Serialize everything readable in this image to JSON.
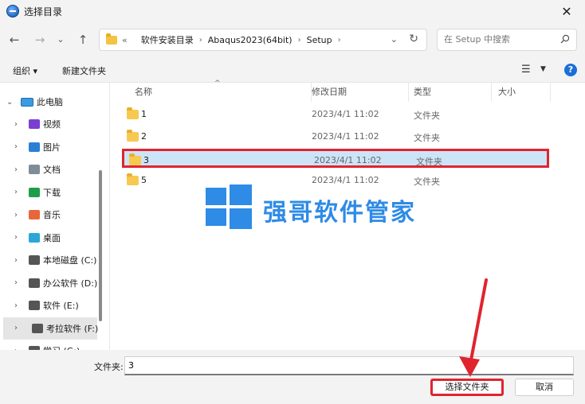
{
  "window": {
    "title": "选择目录",
    "close_glyph": "✕"
  },
  "navbar": {
    "back_glyph": "←",
    "forward_glyph": "→",
    "recent_glyph": "⌄",
    "up_glyph": "↑",
    "breadcrumb_prefix": "«",
    "breadcrumb": [
      "软件安装目录",
      "Abaqus2023(64bit)",
      "Setup"
    ],
    "search_placeholder": "在 Setup 中搜索",
    "refresh_glyph": "↻",
    "dropdown_glyph": "⌄"
  },
  "toolbar": {
    "organize": "组织 ▾",
    "new_folder": "新建文件夹",
    "view_glyph": "☰",
    "view_dd": "▼",
    "help_glyph": "?"
  },
  "sidebar": {
    "root": "此电脑",
    "items": [
      {
        "label": "视频",
        "icon": "video-icon",
        "color": "#7a3fd1"
      },
      {
        "label": "图片",
        "icon": "picture-icon",
        "color": "#2a7fd4"
      },
      {
        "label": "文档",
        "icon": "document-icon",
        "color": "#7f8c99"
      },
      {
        "label": "下载",
        "icon": "download-icon",
        "color": "#1f9e4a"
      },
      {
        "label": "音乐",
        "icon": "music-icon",
        "color": "#e8673a"
      },
      {
        "label": "桌面",
        "icon": "desktop-icon",
        "color": "#2aa7d8"
      },
      {
        "label": "本地磁盘 (C:)",
        "icon": "drive-c-icon",
        "color": "#555555"
      },
      {
        "label": "办公软件 (D:)",
        "icon": "drive-icon",
        "color": "#555555"
      },
      {
        "label": "软件 (E:)",
        "icon": "drive-icon",
        "color": "#555555"
      },
      {
        "label": "考拉软件 (F:)",
        "icon": "drive-icon",
        "color": "#555555"
      },
      {
        "label": "学习 (G:)",
        "icon": "drive-icon",
        "color": "#555555"
      }
    ],
    "chevron_glyph": "›",
    "chevron_open_glyph": "⌄"
  },
  "columns": {
    "name": "名称",
    "modified": "修改日期",
    "type": "类型",
    "size": "大小",
    "sort_glyph": "^"
  },
  "files": [
    {
      "name": "1",
      "modified": "2023/4/1 11:02",
      "type": "文件夹"
    },
    {
      "name": "2",
      "modified": "2023/4/1 11:02",
      "type": "文件夹"
    },
    {
      "name": "3",
      "modified": "2023/4/1 11:02",
      "type": "文件夹"
    },
    {
      "name": "5",
      "modified": "2023/4/1 11:02",
      "type": "文件夹"
    }
  ],
  "watermark": "强哥软件管家",
  "bottom": {
    "folder_label": "文件夹:",
    "folder_value": "3",
    "select_button": "选择文件夹",
    "cancel_button": "取消"
  },
  "colors": {
    "accent": "#2e8be6",
    "highlight": "#e0242f",
    "selection": "#cce4f7"
  }
}
